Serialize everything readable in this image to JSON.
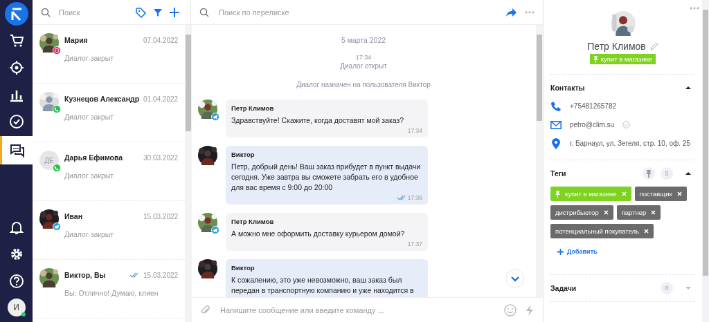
{
  "nav": {
    "items": [
      {
        "kind": "logo",
        "selected": false
      },
      {
        "kind": "cart",
        "selected": false
      },
      {
        "kind": "target",
        "selected": false
      },
      {
        "kind": "chart",
        "selected": false
      },
      {
        "kind": "check",
        "selected": false
      },
      {
        "kind": "chat",
        "selected": true
      },
      {
        "kind": "bell",
        "selected": false
      },
      {
        "kind": "gear",
        "selected": false
      },
      {
        "kind": "help",
        "selected": false
      }
    ],
    "user": {
      "initial": "И",
      "online": true
    }
  },
  "list": {
    "search": {
      "placeholder": "Поиск"
    },
    "conversations": [
      {
        "name": "Мария",
        "date": "07.04.2022",
        "preview": "Диалог закрыт",
        "badge": {
          "kind": "instagram"
        },
        "read": false
      },
      {
        "name": "Кузнецов Александр",
        "date": "01.04.2022",
        "preview": "Диалог закрыт",
        "badge": {
          "kind": "whatsapp"
        },
        "read": false
      },
      {
        "name": "Дарья Ефимова",
        "date": "30.03.2022",
        "preview": "Диалог закрыт",
        "avatar": {
          "kind": "initials",
          "text": "ДЕ"
        },
        "badge": {
          "kind": "whatsapp"
        },
        "read": false
      },
      {
        "name": "Иван",
        "date": "15.03.2022",
        "preview": "Диалог закрыт",
        "badge": {
          "kind": "telegram"
        },
        "read": false
      },
      {
        "name": "Виктор, Вы",
        "date": "15.03.2022",
        "preview": "Вы: Отлично! Думаю, клиен",
        "read": true
      }
    ]
  },
  "chat": {
    "search": {
      "placeholder": "Поиск по переписке"
    },
    "events": [
      {
        "kind": "date",
        "text": "5 марта 2022"
      },
      {
        "kind": "time",
        "text": "17:34"
      },
      {
        "kind": "note",
        "text": "Диалог открыт"
      },
      {
        "kind": "note",
        "text": "Диалог назначен на пользователя Виктор"
      }
    ],
    "messages": [
      {
        "kind": "incoming",
        "sender": "Петр Климов",
        "text": "Здравствуйте! Скажите, когда доставят мой заказ?",
        "time": "17:34",
        "read": false,
        "badge": {
          "kind": "telegram"
        }
      },
      {
        "kind": "outgoing",
        "sender": "Виктор",
        "text": "Петр, добрый день! Ваш заказ прибудет в пункт выдачи сегодня. Уже завтра вы сможете забрать его в удобное для вас время с 9:00 до 20:00",
        "time": "17:36",
        "read": true
      },
      {
        "kind": "incoming",
        "sender": "Петр Климов",
        "text": "А можно мне оформить доставку курьером домой?",
        "time": "17:37",
        "read": false,
        "badge": {
          "kind": "telegram"
        }
      },
      {
        "kind": "outgoing",
        "sender": "Виктор",
        "text": "К сожалению, это уже невозможно, ваш заказ был передан в транспортную компанию и уже находится в"
      }
    ],
    "composer": {
      "placeholder": "Напишите сообщение или введите команду ..."
    }
  },
  "contact": {
    "name": "Петр Климов",
    "pinned_tag": "купит в магазине",
    "contacts": {
      "title": "Контакты",
      "expanded": true,
      "items": [
        {
          "kind": "phone",
          "text": "+75481265782",
          "verified": false
        },
        {
          "kind": "email",
          "text": "petro@clim.su",
          "verified": true
        },
        {
          "kind": "address",
          "text": "г. Барнаул, ул. Зегеля, стр. 10, оф. 25",
          "verified": false
        }
      ]
    },
    "tags": {
      "title": "Теги",
      "count": "5",
      "expanded": true,
      "items": [
        {
          "label": "купит в магазине",
          "pinned": true
        },
        {
          "label": "поставщик",
          "pinned": false
        },
        {
          "label": "дистрибьютор",
          "pinned": false
        },
        {
          "label": "партнер",
          "pinned": false
        },
        {
          "label": "потенциальный покупатель",
          "pinned": false
        }
      ],
      "add": "Добавить"
    },
    "tasks": {
      "title": "Задачи",
      "count": "0",
      "expanded": false
    }
  }
}
